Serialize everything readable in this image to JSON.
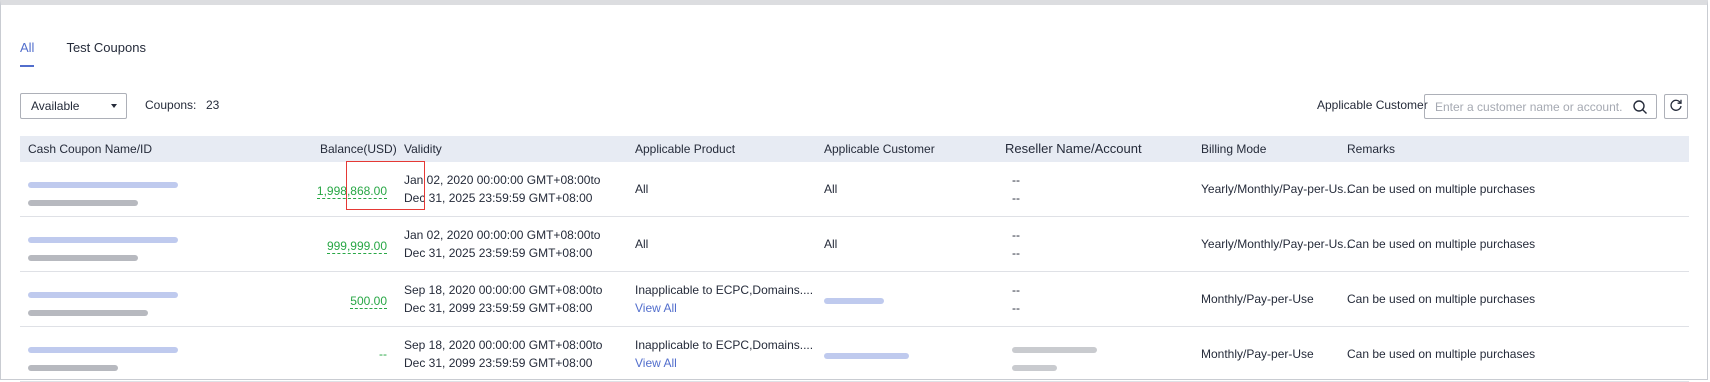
{
  "tabs": [
    {
      "label": "All",
      "active": true
    },
    {
      "label": "Test Coupons",
      "active": false
    }
  ],
  "toolbar": {
    "status_select": "Available",
    "coupons_label": "Coupons:",
    "coupons_count": "23",
    "customer_label": "Applicable Customer",
    "search_placeholder": "Enter a customer name or account."
  },
  "table": {
    "headers": {
      "name": "Cash Coupon Name/ID",
      "balance": "Balance(USD)",
      "validity": "Validity",
      "product": "Applicable Product",
      "customer": "Applicable Customer",
      "reseller": "Reseller Name/Account",
      "billing": "Billing Mode",
      "remarks": "Remarks"
    },
    "rows": [
      {
        "balance": "1,998,868.00",
        "validity_from": "Jan 02, 2020 00:00:00 GMT+08:00to",
        "validity_to": "Dec 31, 2025 23:59:59 GMT+08:00",
        "product": "All",
        "product_link": "",
        "customer": "All",
        "reseller_1": "--",
        "reseller_2": "--",
        "billing": "Yearly/Monthly/Pay-per-Us...",
        "remarks": "Can be used on multiple purchases"
      },
      {
        "balance": "999,999.00",
        "validity_from": "Jan 02, 2020 00:00:00 GMT+08:00to",
        "validity_to": "Dec 31, 2025 23:59:59 GMT+08:00",
        "product": "All",
        "product_link": "",
        "customer": "All",
        "reseller_1": "--",
        "reseller_2": "--",
        "billing": "Yearly/Monthly/Pay-per-Us...",
        "remarks": "Can be used on multiple purchases"
      },
      {
        "balance": "500.00",
        "validity_from": "Sep 18, 2020 00:00:00 GMT+08:00to",
        "validity_to": "Dec 31, 2099 23:59:59 GMT+08:00",
        "product": "Inapplicable to ECPC,Domains....",
        "product_link": "View All",
        "customer": "",
        "reseller_1": "--",
        "reseller_2": "--",
        "billing": "Monthly/Pay-per-Use",
        "remarks": "Can be used on multiple purchases"
      },
      {
        "balance": "--",
        "validity_from": "Sep 18, 2020 00:00:00 GMT+08:00to",
        "validity_to": "Dec 31, 2099 23:59:59 GMT+08:00",
        "product": "Inapplicable to ECPC,Domains....",
        "product_link": "View All",
        "customer": "",
        "reseller_1": "",
        "reseller_2": "",
        "billing": "Monthly/Pay-per-Use",
        "remarks": "Can be used on multiple purchases"
      }
    ]
  },
  "colors": {
    "accent": "#526ecc",
    "balance_green": "#28a745",
    "highlight_red": "#e53935",
    "header_bg": "#e7ebf3"
  }
}
